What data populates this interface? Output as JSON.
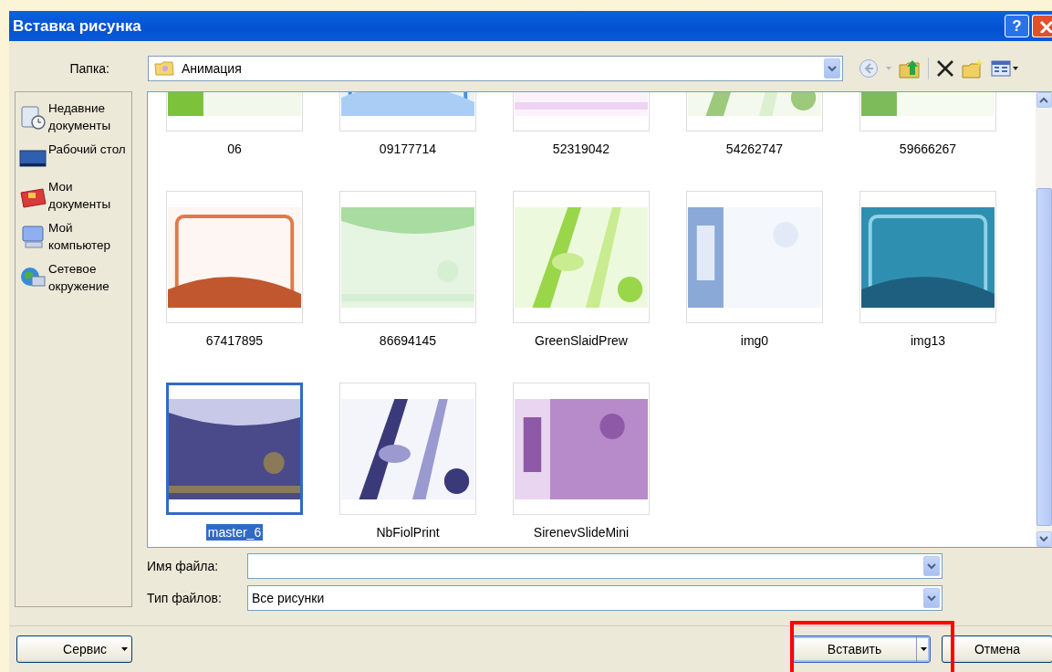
{
  "window": {
    "title": "Вставка рисунка",
    "help": "?"
  },
  "folder": {
    "label": "Папка:",
    "value": "Анимация"
  },
  "places": [
    {
      "label": "Недавние документы"
    },
    {
      "label": "Рабочий стол"
    },
    {
      "label": "Мои документы"
    },
    {
      "label": "Мой компьютер"
    },
    {
      "label": "Сетевое окружение"
    }
  ],
  "files": [
    {
      "name": "06",
      "selected": false
    },
    {
      "name": "09177714",
      "selected": false
    },
    {
      "name": "52319042",
      "selected": false
    },
    {
      "name": "54262747",
      "selected": false
    },
    {
      "name": "59666267",
      "selected": false
    },
    {
      "name": "67417895",
      "selected": false
    },
    {
      "name": "86694145",
      "selected": false
    },
    {
      "name": "GreenSlaidPrew",
      "selected": false
    },
    {
      "name": "img0",
      "selected": false
    },
    {
      "name": "img13",
      "selected": false
    },
    {
      "name": "master_6",
      "selected": true
    },
    {
      "name": "NbFiolPrint",
      "selected": false
    },
    {
      "name": "SirenevSlideMini",
      "selected": false
    }
  ],
  "file_name": {
    "label": "Имя файла:"
  },
  "file_type": {
    "label": "Тип файлов:",
    "value": "Все рисунки"
  },
  "buttons": {
    "tools": "Сервис",
    "insert": "Вставить",
    "cancel": "Отмена"
  }
}
